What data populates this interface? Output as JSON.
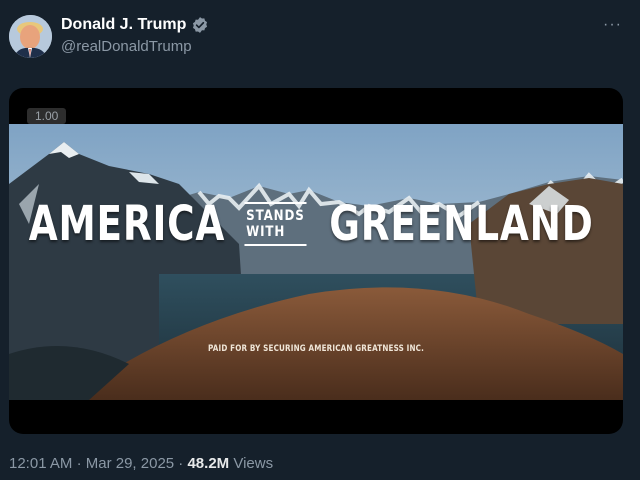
{
  "author": {
    "display_name": "Donald J. Trump",
    "handle": "@realDonaldTrump",
    "verified": true
  },
  "post_menu": {
    "more_label": "···"
  },
  "media": {
    "playback_speed": "1.00",
    "overlay": {
      "word_left": "AMERICA",
      "phrase_middle": "STANDS WITH",
      "word_right": "GREENLAND"
    },
    "disclaimer": "PAID FOR BY SECURING AMERICAN GREATNESS INC."
  },
  "meta": {
    "time": "12:01 AM",
    "separator": "·",
    "date": "Mar 29, 2025",
    "views_count": "48.2M",
    "views_label": "Views"
  },
  "colors": {
    "background": "#15202b",
    "verified_badge": "#8b98a5",
    "secondary_text": "#8b98a5"
  }
}
